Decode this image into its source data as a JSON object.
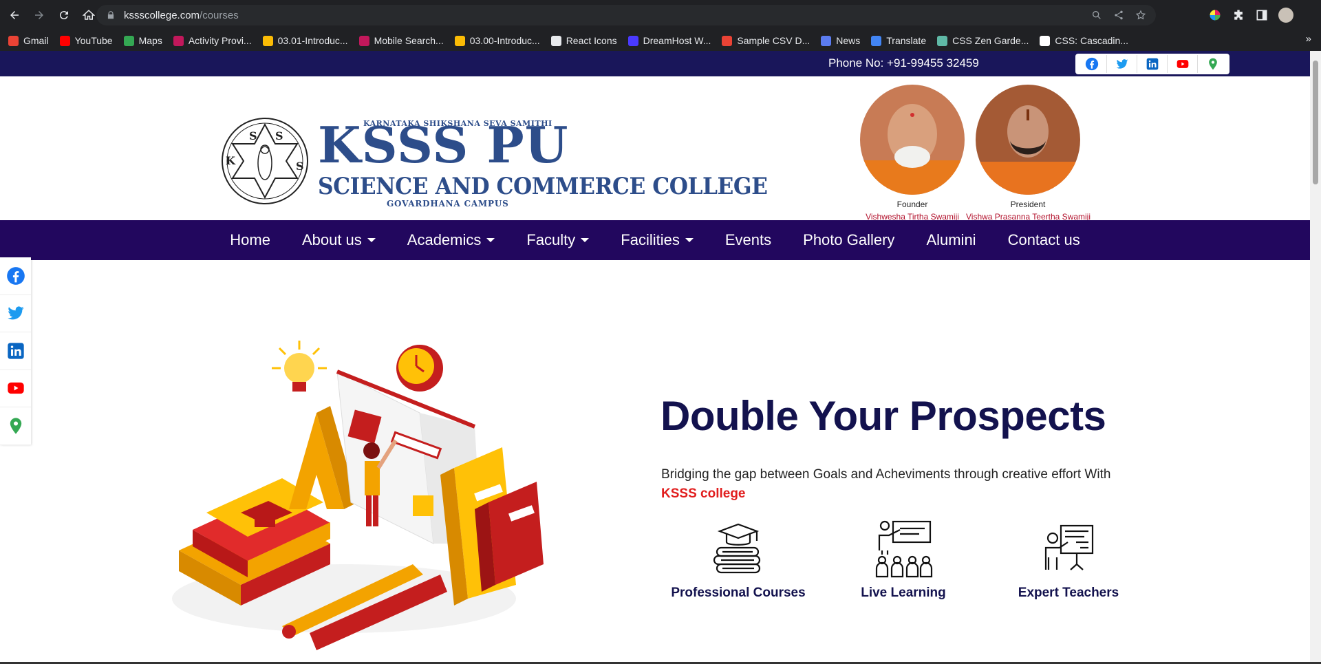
{
  "browser": {
    "url_host": "kssscollege.com",
    "url_path": "/courses",
    "bookmarks": [
      {
        "label": "Gmail",
        "color": "#ea4335"
      },
      {
        "label": "YouTube",
        "color": "#ff0000"
      },
      {
        "label": "Maps",
        "color": "#34a853"
      },
      {
        "label": "Activity Provi...",
        "color": "#c2185b"
      },
      {
        "label": "03.01-Introduc...",
        "color": "#fbbc05"
      },
      {
        "label": "Mobile Search...",
        "color": "#c2185b"
      },
      {
        "label": "03.00-Introduc...",
        "color": "#fbbc05"
      },
      {
        "label": "React Icons",
        "color": "#e8eaed"
      },
      {
        "label": "DreamHost W...",
        "color": "#4a3aff"
      },
      {
        "label": "Sample CSV D...",
        "color": "#ea4335"
      },
      {
        "label": "News",
        "color": "#5b7cf0"
      },
      {
        "label": "Translate",
        "color": "#4285f4"
      },
      {
        "label": "CSS Zen Garde...",
        "color": "#5fb9a6"
      },
      {
        "label": "CSS: Cascadin...",
        "color": "#ffffff"
      }
    ],
    "more": "»"
  },
  "topbar": {
    "phone": "Phone No: +91-99455 32459",
    "social": [
      "facebook",
      "twitter",
      "linkedin",
      "youtube",
      "location"
    ]
  },
  "header": {
    "org": "KARNATAKA SHIKSHANA SEVA SAMITHI",
    "name": "KSSS PU",
    "subtitle": "SCIENCE AND COMMERCE COLLEGE",
    "campus": "GOVARDHANA CAMPUS",
    "people": [
      {
        "role": "Founder",
        "name": "Vishwesha Tirtha Swamiji"
      },
      {
        "role": "President",
        "name": "Vishwa Prasanna Teertha Swamiji"
      }
    ]
  },
  "nav": [
    {
      "label": "Home",
      "dropdown": false
    },
    {
      "label": "About us",
      "dropdown": true
    },
    {
      "label": "Academics",
      "dropdown": true
    },
    {
      "label": "Faculty",
      "dropdown": true
    },
    {
      "label": "Facilities",
      "dropdown": true
    },
    {
      "label": "Events",
      "dropdown": false
    },
    {
      "label": "Photo Gallery",
      "dropdown": false
    },
    {
      "label": "Alumini",
      "dropdown": false
    },
    {
      "label": "Contact us",
      "dropdown": false
    }
  ],
  "hero": {
    "title": "Double Your Prospects",
    "text": "Bridging the gap between Goals and Acheviments through creative effort With ",
    "highlight": "KSSS college",
    "features": [
      {
        "label": "Professional Courses",
        "icon": "graduation-books-icon"
      },
      {
        "label": "Live Learning",
        "icon": "classroom-icon"
      },
      {
        "label": "Expert Teachers",
        "icon": "teacher-board-icon"
      }
    ]
  }
}
